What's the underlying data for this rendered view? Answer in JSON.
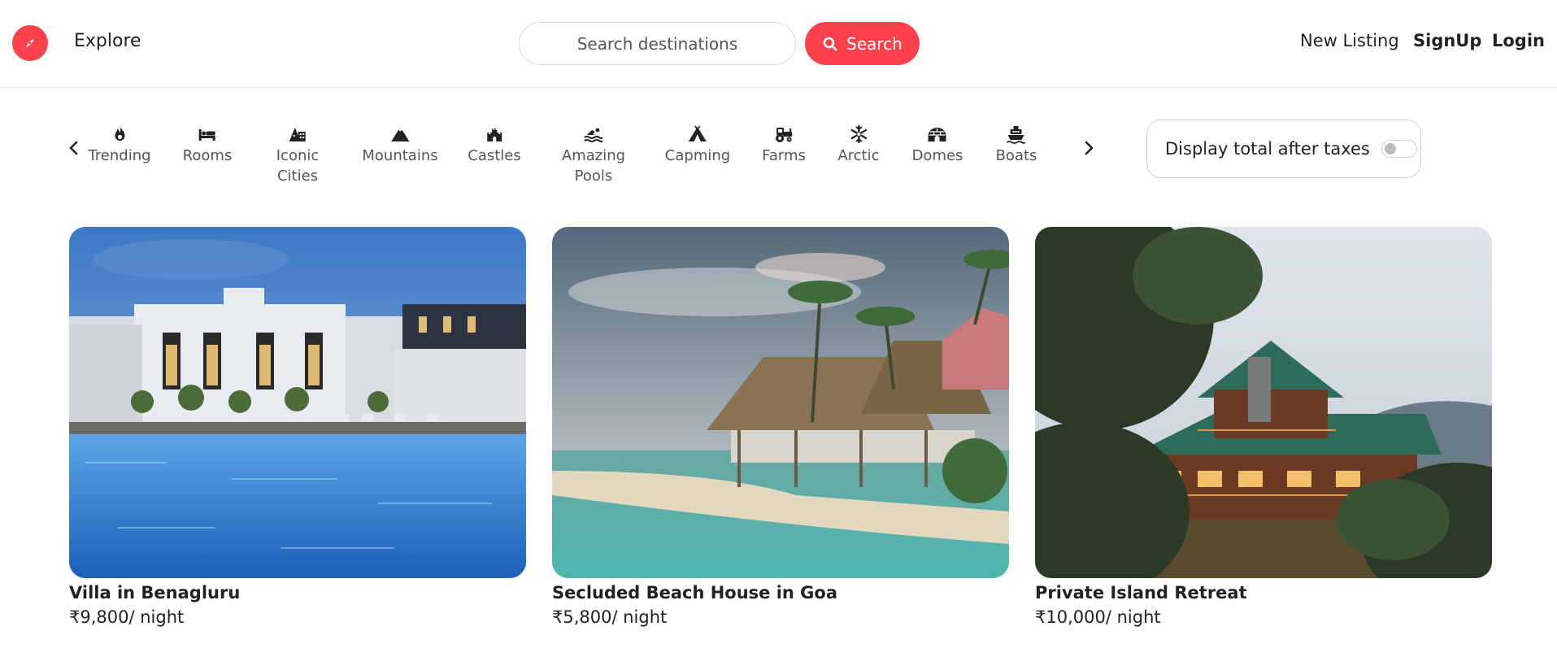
{
  "nav": {
    "explore": "Explore",
    "search_placeholder": "Search destinations",
    "search_button": "Search",
    "new_listing": "New Listing",
    "signup": "SignUp",
    "login": "Login"
  },
  "filters": [
    {
      "label": "Trending",
      "icon": "fire-icon"
    },
    {
      "label": "Rooms",
      "icon": "bed-icon"
    },
    {
      "label": "Iconic\nCities",
      "icon": "city-icon"
    },
    {
      "label": "Mountains",
      "icon": "mountain-icon"
    },
    {
      "label": "Castles",
      "icon": "castle-icon"
    },
    {
      "label": "Amazing\nPools",
      "icon": "swimmer-icon"
    },
    {
      "label": "Capming",
      "icon": "tent-icon"
    },
    {
      "label": "Farms",
      "icon": "tractor-icon"
    },
    {
      "label": "Arctic",
      "icon": "snowflake-icon"
    },
    {
      "label": "Domes",
      "icon": "igloo-icon"
    },
    {
      "label": "Boats",
      "icon": "ship-icon"
    }
  ],
  "tax_toggle": {
    "label": "Display total after taxes",
    "enabled": false
  },
  "listings": [
    {
      "title": "Villa in Benagluru",
      "price": "₹9,800/ night"
    },
    {
      "title": "Secluded Beach House in Goa",
      "price": "₹5,800/ night"
    },
    {
      "title": "Private Island Retreat",
      "price": "₹10,000/ night"
    }
  ],
  "colors": {
    "brand": "#fe424d"
  }
}
